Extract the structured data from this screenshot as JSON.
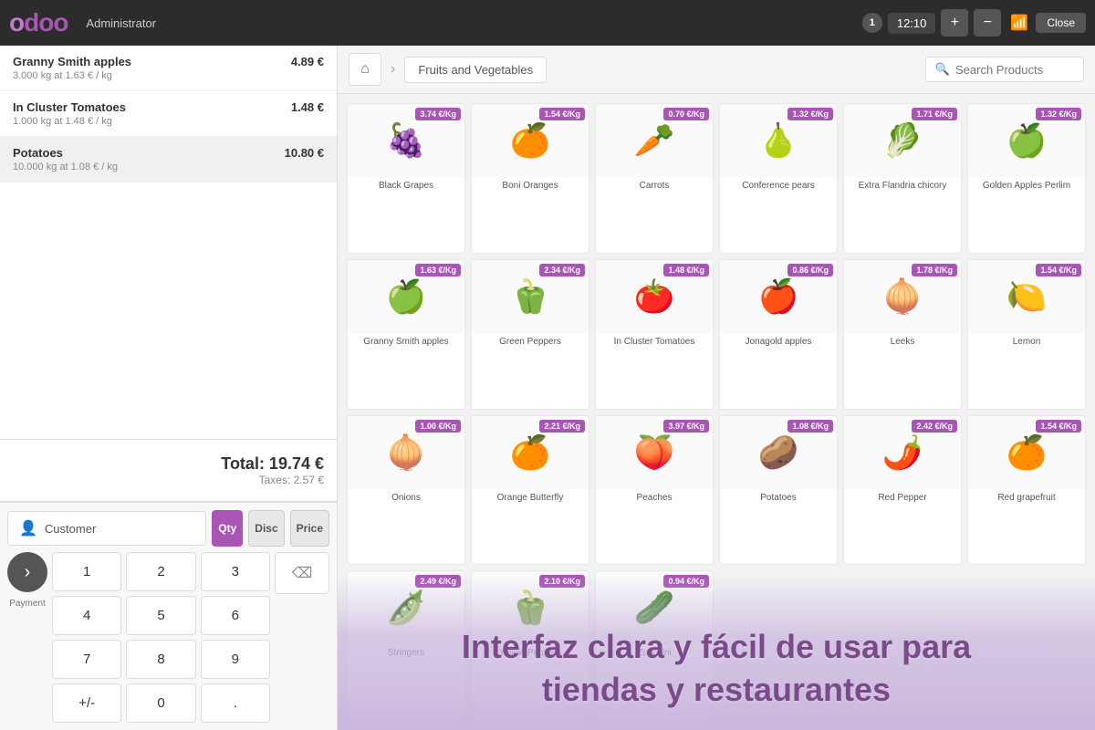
{
  "app": {
    "logo": "odoo",
    "admin_label": "Administrator",
    "session_number": "1",
    "time": "12:10",
    "add_label": "+",
    "minus_label": "−",
    "close_label": "Close"
  },
  "order": {
    "items": [
      {
        "name": "Granny Smith apples",
        "price": "4.89 €",
        "detail": "3.000 kg at 1.63 € / kg"
      },
      {
        "name": "In Cluster Tomatoes",
        "price": "1.48 €",
        "detail": "1.000 kg at 1.48 € / kg",
        "selected": false
      },
      {
        "name": "Potatoes",
        "price": "10.80 €",
        "detail": "10.000 kg at 1.08 € / kg",
        "selected": true
      }
    ],
    "total_label": "Total: 19.74 €",
    "taxes_label": "Taxes: 2.57 €"
  },
  "numpad": {
    "customer_label": "Customer",
    "payment_label": "Payment",
    "buttons": [
      "1",
      "2",
      "3",
      "4",
      "5",
      "6",
      "7",
      "8",
      "9",
      "+/-",
      "0",
      "."
    ],
    "mode_buttons": [
      "Qty",
      "Disc",
      "Price"
    ]
  },
  "products": {
    "home_icon": "⌂",
    "breadcrumb_sep": "›",
    "category": "Fruits and Vegetables",
    "search_placeholder": "Search Products",
    "items": [
      {
        "name": "Black Grapes",
        "price": "3.74 €/Kg",
        "emoji": "🍇"
      },
      {
        "name": "Boni Oranges",
        "price": "1.54 €/Kg",
        "emoji": "🍊"
      },
      {
        "name": "Carrots",
        "price": "0.70 €/Kg",
        "emoji": "🥕"
      },
      {
        "name": "Conference pears",
        "price": "1.32 €/Kg",
        "emoji": "🍐"
      },
      {
        "name": "Extra Flandria chicory",
        "price": "1.71 €/Kg",
        "emoji": "🥬"
      },
      {
        "name": "Golden Apples Perlim",
        "price": "1.32 €/Kg",
        "emoji": "🍏"
      },
      {
        "name": "Granny Smith apples",
        "price": "1.63 €/Kg",
        "emoji": "🍏"
      },
      {
        "name": "Green Peppers",
        "price": "2.34 €/Kg",
        "emoji": "🫑"
      },
      {
        "name": "In Cluster Tomatoes",
        "price": "1.48 €/Kg",
        "emoji": "🍅"
      },
      {
        "name": "Jonagold apples",
        "price": "0.86 €/Kg",
        "emoji": "🍎"
      },
      {
        "name": "Leeks",
        "price": "1.78 €/Kg",
        "emoji": "🧅"
      },
      {
        "name": "Lemon",
        "price": "1.54 €/Kg",
        "emoji": "🍋"
      },
      {
        "name": "Onions",
        "price": "1.00 €/Kg",
        "emoji": "🧅"
      },
      {
        "name": "Orange Butterfly",
        "price": "2.21 €/Kg",
        "emoji": "🍊"
      },
      {
        "name": "Peaches",
        "price": "3.97 €/Kg",
        "emoji": "🍑"
      },
      {
        "name": "Potatoes",
        "price": "1.08 €/Kg",
        "emoji": "🥔"
      },
      {
        "name": "Red Pepper",
        "price": "2.42 €/Kg",
        "emoji": "🌶️"
      },
      {
        "name": "Red grapefruit",
        "price": "1.54 €/Kg",
        "emoji": "🍊"
      },
      {
        "name": "Stringers",
        "price": "2.49 €/Kg",
        "emoji": "🫛"
      },
      {
        "name": "Yellow Peppers",
        "price": "2.10 €/Kg",
        "emoji": "🫑"
      },
      {
        "name": "Zucchini",
        "price": "0.94 €/Kg",
        "emoji": "🥒"
      }
    ]
  },
  "marketing": {
    "line1": "Interfaz clara y fácil de usar para",
    "line2": "tiendas y restaurantes"
  }
}
